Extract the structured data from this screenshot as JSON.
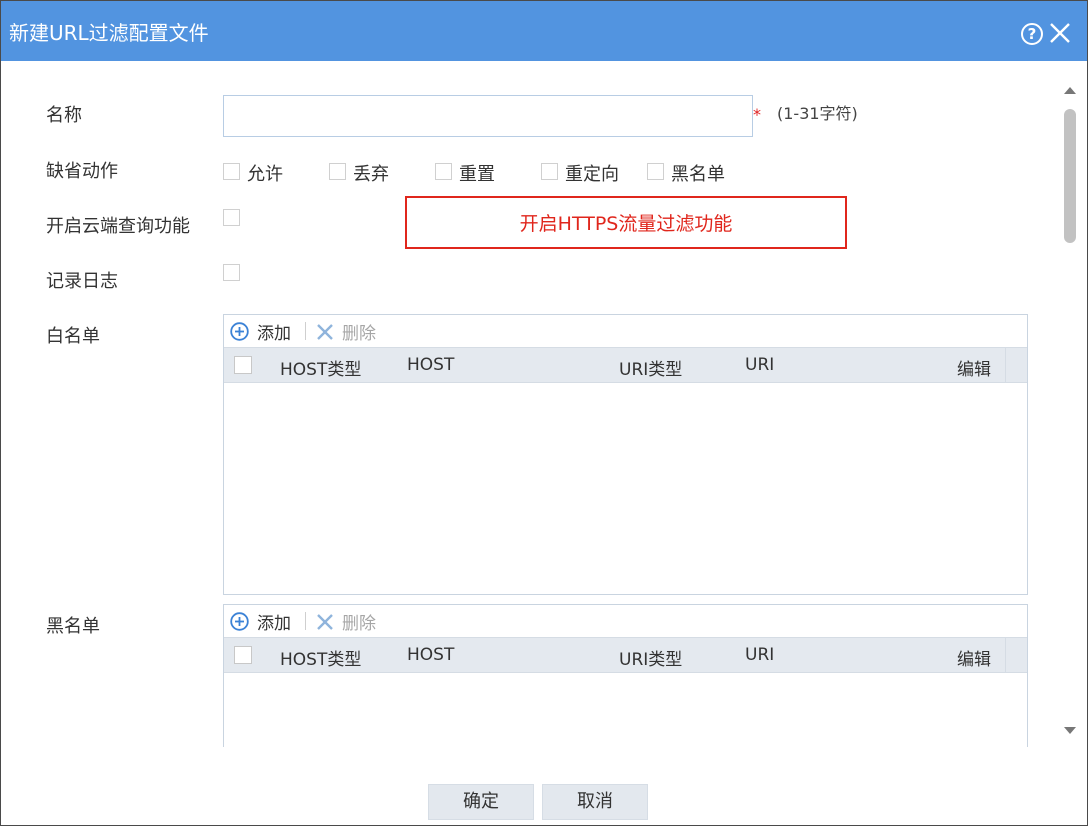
{
  "dialog": {
    "title": "新建URL过滤配置文件",
    "help_symbol": "?"
  },
  "form": {
    "name_label": "名称",
    "name_value": "",
    "name_required_mark": "*",
    "name_hint": "(1-31字符)",
    "default_action_label": "缺省动作",
    "default_actions": [
      "允许",
      "丢弃",
      "重置",
      "重定向",
      "黑名单"
    ],
    "cloud_query_label": "开启云端查询功能",
    "log_label": "记录日志",
    "whitelist_label": "白名单",
    "blacklist_label": "黑名单"
  },
  "annotation": {
    "text": "开启HTTPS流量过滤功能",
    "color": "#e0261c"
  },
  "grid": {
    "add_label": "添加",
    "delete_label": "删除",
    "columns": [
      "HOST类型",
      "HOST",
      "URI类型",
      "URI",
      "编辑"
    ]
  },
  "footer": {
    "ok_label": "确定",
    "cancel_label": "取消"
  },
  "colors": {
    "titlebar": "#5294e0",
    "grid_header": "#e4e9ef",
    "button_bg": "#e3e8ee",
    "add_icon": "#3b82d6",
    "delete_icon": "#8fb4dc"
  }
}
